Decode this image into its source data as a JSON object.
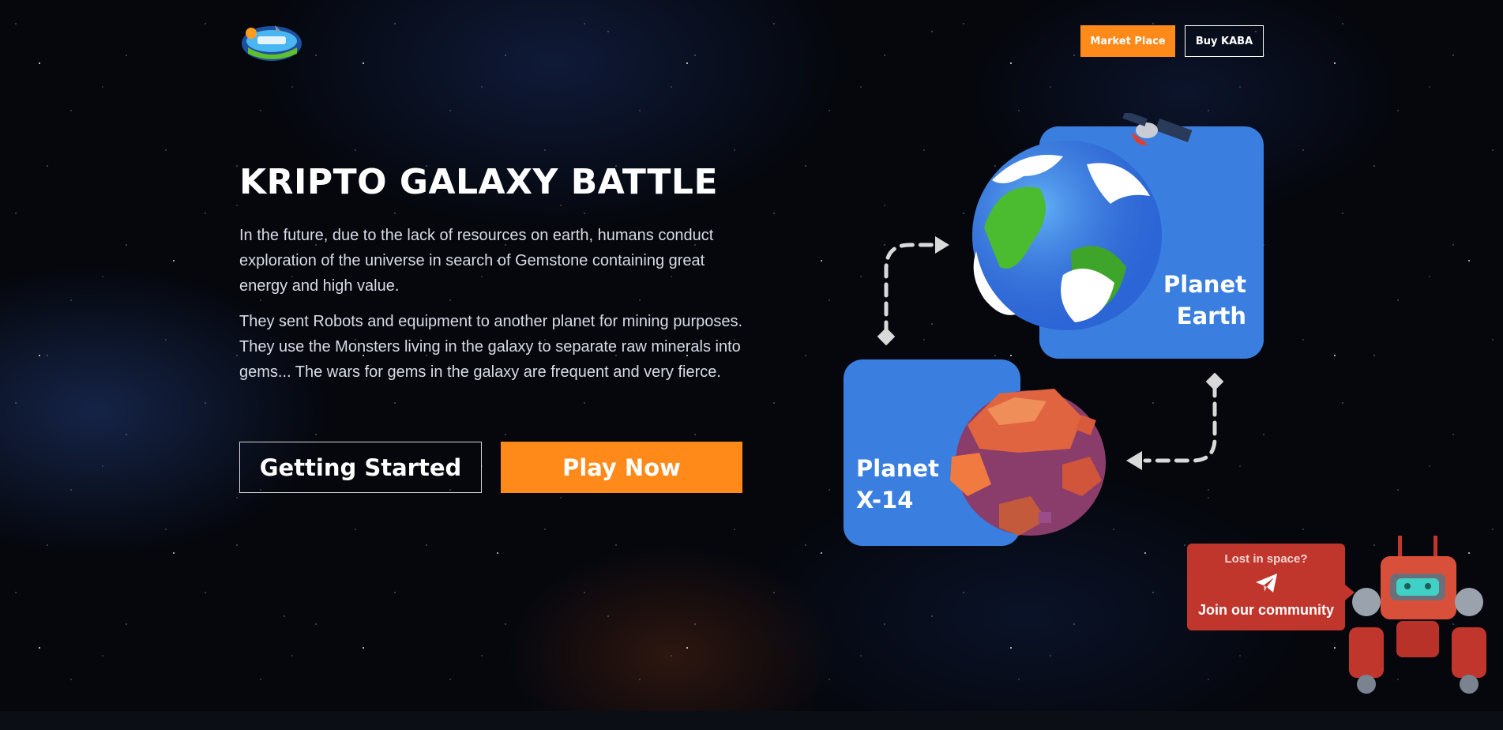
{
  "header": {
    "logo_icon": "kripto-galaxy-battle-logo",
    "nav": {
      "market_place": "Market Place",
      "buy_kaba": "Buy KABA"
    }
  },
  "hero": {
    "title": "KRIPTO GALAXY BATTLE",
    "paragraphs": [
      "In the future, due to the lack of resources on earth, humans conduct exploration of the universe in search of Gemstone containing great energy and high value.",
      "They sent Robots and equipment to another planet for mining purposes. They use the Monsters living in the galaxy to separate raw minerals into gems... The wars for gems in the galaxy are frequent and very fierce."
    ],
    "buttons": {
      "getting_started": "Getting Started",
      "play_now": "Play Now"
    }
  },
  "planets": [
    {
      "line1": "Planet",
      "line2": "Earth"
    },
    {
      "line1": "Planet",
      "line2": "X-14"
    }
  ],
  "community": {
    "question": "Lost in space?",
    "icon": "telegram-icon",
    "cta": "Join our community"
  },
  "colors": {
    "accent_orange": "#ff8a1a",
    "card_blue": "#3a7fe0",
    "bubble_red": "#c0352c",
    "background": "#05070d"
  }
}
